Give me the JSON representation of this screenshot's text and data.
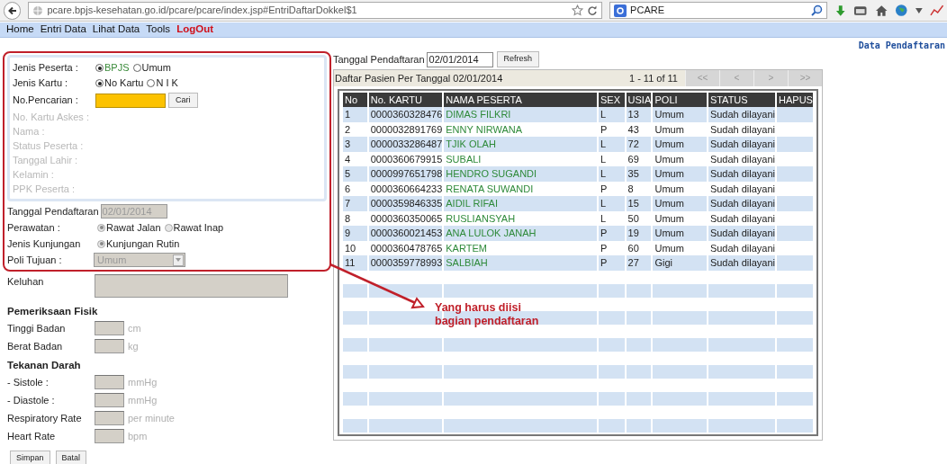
{
  "browser": {
    "url": "pcare.bpjs-kesehatan.go.id/pcare/pcare/index.jsp#EntriDaftarDokkel$1",
    "search": "PCARE"
  },
  "menu": [
    {
      "label": "Home",
      "kind": "normal"
    },
    {
      "label": "Entri Data",
      "kind": "normal"
    },
    {
      "label": "Lihat Data",
      "kind": "normal"
    },
    {
      "label": "Tools",
      "kind": "normal"
    },
    {
      "label": "LogOut",
      "kind": "logout"
    }
  ],
  "page_title": "Data Pendaftaran",
  "participant_box": [
    {
      "kind": "radio",
      "label": "Jenis Peserta :",
      "options": [
        {
          "label": "BPJS",
          "selected": true,
          "color": "#3a8a3a"
        },
        {
          "label": "Umum",
          "selected": false
        }
      ]
    },
    {
      "kind": "radio",
      "label": "Jenis Kartu :",
      "options": [
        {
          "label": "No Kartu",
          "selected": true
        },
        {
          "label": "N I K",
          "selected": false
        }
      ]
    },
    {
      "kind": "search",
      "label": "No.Pencarian :",
      "button": "Cari"
    },
    {
      "kind": "info",
      "label": "No. Kartu Askes :"
    },
    {
      "kind": "info",
      "label": "Nama :"
    },
    {
      "kind": "info",
      "label": "Status Peserta :"
    },
    {
      "kind": "info",
      "label": "Tanggal Lahir :"
    },
    {
      "kind": "info",
      "label": "Kelamin :"
    },
    {
      "kind": "info",
      "label": "PPK Peserta :"
    }
  ],
  "registration": [
    {
      "kind": "date",
      "label": "Tanggal Pendaftaran",
      "value": "02/01/2014",
      "disabled": true
    },
    {
      "kind": "radio",
      "label": "Perawatan :",
      "disabled": true,
      "options": [
        {
          "label": "Rawat Jalan",
          "selected": true
        },
        {
          "label": "Rawat Inap",
          "selected": false
        }
      ]
    },
    {
      "kind": "radio",
      "label": "Jenis Kunjungan",
      "disabled": true,
      "options": [
        {
          "label": "Kunjungan Rutin",
          "selected": true
        }
      ]
    },
    {
      "kind": "select",
      "label": "Poli Tujuan :",
      "value": "Umum",
      "disabled": true
    }
  ],
  "examination": [
    {
      "kind": "textarea",
      "label": "Keluhan"
    },
    {
      "kind": "heading",
      "label": "Pemeriksaan Fisik"
    },
    {
      "kind": "measure",
      "label": "Tinggi Badan",
      "unit": "cm"
    },
    {
      "kind": "measure",
      "label": "Berat Badan",
      "unit": "kg"
    },
    {
      "kind": "heading",
      "label": "Tekanan Darah"
    },
    {
      "kind": "measure",
      "label": "- Sistole :",
      "unit": "mmHg"
    },
    {
      "kind": "measure",
      "label": "- Diastole :",
      "unit": "mmHg"
    },
    {
      "kind": "measure",
      "label": "Respiratory Rate",
      "unit": "per minute"
    },
    {
      "kind": "measure",
      "label": "Heart Rate",
      "unit": "bpm"
    }
  ],
  "form_buttons": [
    "Simpan",
    "Batal"
  ],
  "date_filter": {
    "label": "Tanggal Pendaftaran",
    "value": "02/01/2014",
    "button": "Refresh"
  },
  "patient_list": {
    "title": "Daftar Pasien Per Tanggal 02/01/2014",
    "range": "1 - 11 of 11",
    "pager": [
      "<<",
      "<",
      ">",
      ">>"
    ],
    "columns": [
      "No",
      "No. KARTU",
      "NAMA PESERTA",
      "SEX",
      "USIA",
      "POLI",
      "STATUS",
      "HAPUS"
    ],
    "rows": [
      {
        "no": "1",
        "kartu": "0000360328476",
        "nama": "DIMAS FILKRI",
        "sex": "L",
        "usia": "13",
        "poli": "Umum",
        "status": "Sudah dilayani"
      },
      {
        "no": "2",
        "kartu": "0000032891769",
        "nama": "ENNY NIRWANA",
        "sex": "P",
        "usia": "43",
        "poli": "Umum",
        "status": "Sudah dilayani"
      },
      {
        "no": "3",
        "kartu": "0000033286487",
        "nama": "TJIK OLAH",
        "sex": "L",
        "usia": "72",
        "poli": "Umum",
        "status": "Sudah dilayani"
      },
      {
        "no": "4",
        "kartu": "0000360679915",
        "nama": "SUBALI",
        "sex": "L",
        "usia": "69",
        "poli": "Umum",
        "status": "Sudah dilayani"
      },
      {
        "no": "5",
        "kartu": "0000997651798",
        "nama": "HENDRO SUGANDI",
        "sex": "L",
        "usia": "35",
        "poli": "Umum",
        "status": "Sudah dilayani"
      },
      {
        "no": "6",
        "kartu": "0000360664233",
        "nama": "RENATA SUWANDI",
        "sex": "P",
        "usia": "8",
        "poli": "Umum",
        "status": "Sudah dilayani"
      },
      {
        "no": "7",
        "kartu": "0000359846335",
        "nama": "AIDIL RIFAI",
        "sex": "L",
        "usia": "15",
        "poli": "Umum",
        "status": "Sudah dilayani"
      },
      {
        "no": "8",
        "kartu": "0000360350065",
        "nama": "RUSLIANSYAH",
        "sex": "L",
        "usia": "50",
        "poli": "Umum",
        "status": "Sudah dilayani"
      },
      {
        "no": "9",
        "kartu": "0000360021453",
        "nama": "ANA LULOK JANAH",
        "sex": "P",
        "usia": "19",
        "poli": "Umum",
        "status": "Sudah dilayani"
      },
      {
        "no": "10",
        "kartu": "0000360478765",
        "nama": "KARTEM",
        "sex": "P",
        "usia": "60",
        "poli": "Umum",
        "status": "Sudah dilayani"
      },
      {
        "no": "11",
        "kartu": "0000359778993",
        "nama": "SALBIAH",
        "sex": "P",
        "usia": "27",
        "poli": "Gigi",
        "status": "Sudah dilayani"
      }
    ]
  },
  "annotation": {
    "text": "Yang harus diisi bagian pendaftaran"
  }
}
